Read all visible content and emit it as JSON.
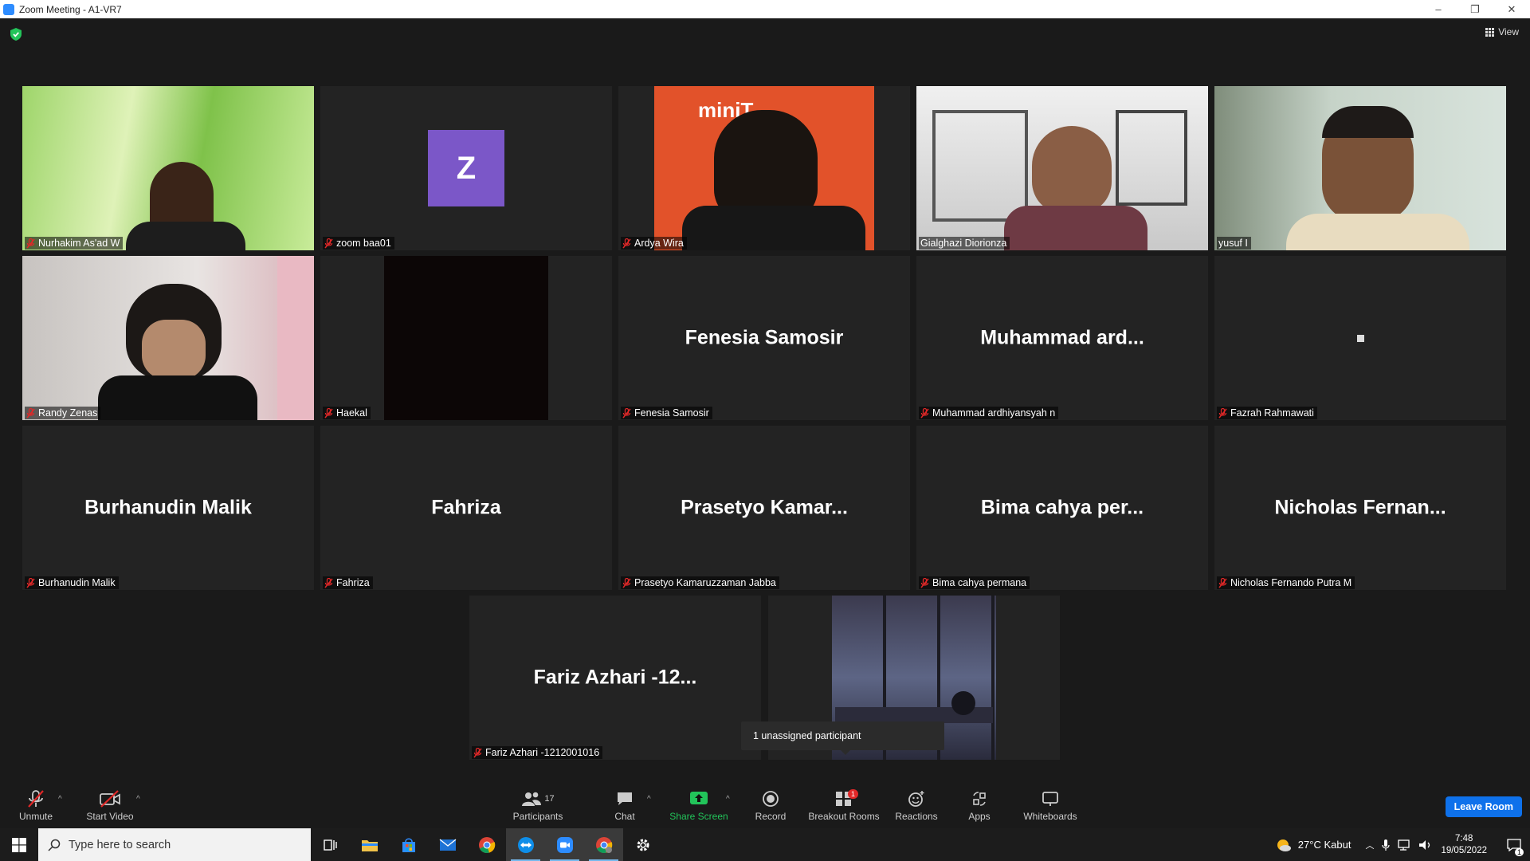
{
  "window": {
    "title": "Zoom Meeting - A1-VR7",
    "minimize": "–",
    "restore": "❐",
    "close": "✕"
  },
  "view_button": {
    "label": "View"
  },
  "tiles": [
    {
      "name": "Nurhakim As'ad W",
      "type": "video",
      "scene": "grass"
    },
    {
      "name": "zoom baa01",
      "type": "avatar",
      "avatar_letter": "Z",
      "avatar_color": "#7b57c8"
    },
    {
      "name": "Ardya Wira",
      "type": "video",
      "scene": "orange"
    },
    {
      "name": "Gialghazi Diorionza",
      "type": "video",
      "scene": "office",
      "muted": false
    },
    {
      "name": "yusuf I",
      "type": "video",
      "scene": "man",
      "muted": false,
      "active_speaker": true
    },
    {
      "name": "Randy Zenas",
      "type": "video",
      "scene": "room"
    },
    {
      "name": "Haekal",
      "type": "video",
      "scene": "black"
    },
    {
      "name": "Fenesia Samosir",
      "type": "name",
      "display": "Fenesia Samosir"
    },
    {
      "name": "Muhammad ardhiyansyah n",
      "type": "name",
      "display": "Muhammad  ard..."
    },
    {
      "name": "Fazrah Rahmawati",
      "type": "dot"
    },
    {
      "name": "Burhanudin Malik",
      "type": "name",
      "display": "Burhanudin Malik"
    },
    {
      "name": "Fahriza",
      "type": "name",
      "display": "Fahriza"
    },
    {
      "name": "Prasetyo Kamaruzzaman Jabba",
      "type": "name",
      "display": "Prasetyo  Kamar..."
    },
    {
      "name": "Bima cahya permana",
      "type": "name",
      "display": "Bima cahya per..."
    },
    {
      "name": "Nicholas Fernando Putra M",
      "type": "name",
      "display": "Nicholas  Fernan..."
    },
    {
      "name": "Fariz Azhari -1212001016",
      "type": "name",
      "display": "Fariz  Azhari  -12..."
    },
    {
      "name": "",
      "type": "video",
      "scene": "city",
      "no_label": true
    }
  ],
  "tooltip": {
    "text": "1 unassigned participant"
  },
  "toolbar": {
    "unmute": "Unmute",
    "start_video": "Start Video",
    "participants": "Participants",
    "participants_count": "17",
    "chat": "Chat",
    "share_screen": "Share Screen",
    "record": "Record",
    "breakout_rooms": "Breakout Rooms",
    "breakout_badge": "1",
    "reactions": "Reactions",
    "apps": "Apps",
    "whiteboards": "Whiteboards",
    "leave": "Leave Room"
  },
  "taskbar": {
    "search_placeholder": "Type here to search",
    "weather": "27°C  Kabut",
    "time": "7:48",
    "date": "19/05/2022",
    "notification_count": "1"
  },
  "colors": {
    "accent": "#0e71eb",
    "speaker_outline": "#b3d34a",
    "mute_red": "#e02828",
    "share_green": "#22c45a"
  }
}
